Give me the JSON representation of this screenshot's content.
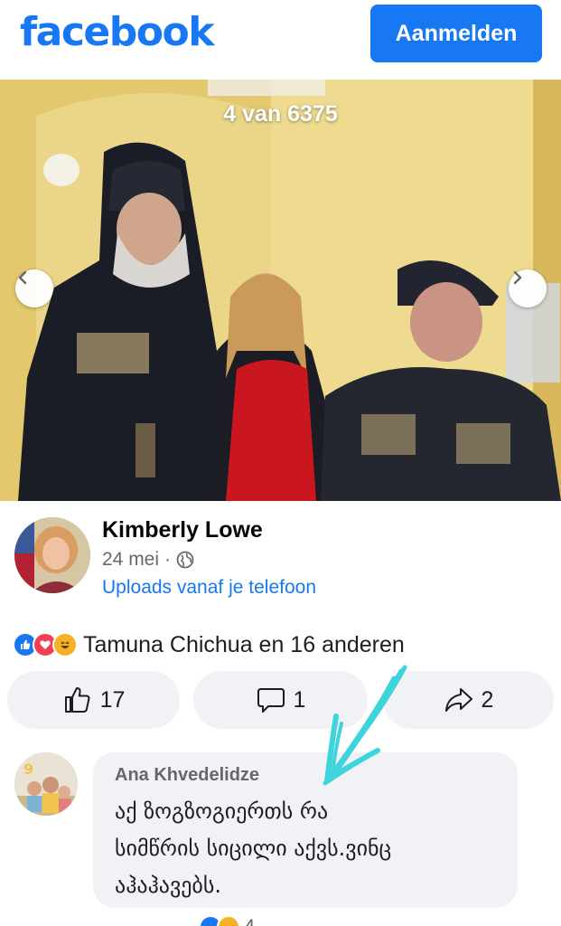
{
  "header": {
    "logo_text": "facebook",
    "login_label": "Aanmelden"
  },
  "photo": {
    "counter": "4 van 6375",
    "prev_icon": "chevron-left-icon",
    "next_icon": "chevron-right-icon"
  },
  "post": {
    "author": "Kimberly Lowe",
    "date": "24 mei",
    "meta_separator": "·",
    "privacy_icon": "globe-icon",
    "source": "Uploads vanaf je telefoon"
  },
  "reactions": {
    "icons": [
      "like-icon",
      "love-icon",
      "haha-icon"
    ],
    "summary": "Tamuna Chichua en 16 anderen"
  },
  "actions": {
    "likes": "17",
    "comments": "1",
    "shares": "2"
  },
  "comment": {
    "author": "Ana Khvedelidze",
    "lines": [
      "აქ ზოგზოგიერთს რა",
      "სიმწრის სიცილი აქვს.ვინც",
      "აჰაჰავებს."
    ]
  },
  "bottom": {
    "count": "4"
  },
  "colors": {
    "brand": "#1877f2",
    "button_bg": "#f0f2f5",
    "secondary_text": "#65676b",
    "annotation": "#3fd3dc"
  }
}
